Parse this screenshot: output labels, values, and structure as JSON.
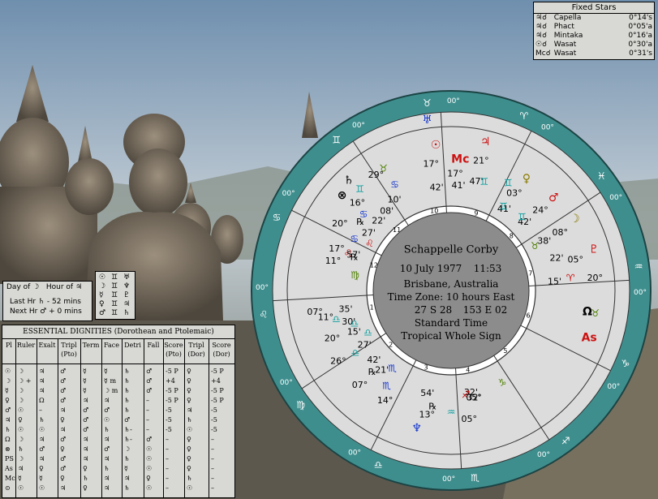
{
  "colors": {
    "outer_ring": "#3f8e8e",
    "house_ring": "#dcdcdc",
    "center": "#8c8c8c",
    "panel": "#d8d8d4",
    "red": "#cc1111",
    "blue": "#1133cc",
    "green": "#4d7f00",
    "olive": "#8a7a00",
    "cyan": "#14a0a0"
  },
  "fixed_stars": {
    "title": "Fixed Stars",
    "rows": [
      {
        "glyph": "♃☌",
        "name": "Capella",
        "value": "0°14's"
      },
      {
        "glyph": "♃☌",
        "name": "Phact",
        "value": "0°05'a"
      },
      {
        "glyph": "♃☌",
        "name": "Mintaka",
        "value": "0°16'a"
      },
      {
        "glyph": "☉☌",
        "name": "Wasat",
        "value": "0°30'a"
      },
      {
        "glyph": "Mc☌",
        "name": "Wasat",
        "value": "0°31's"
      }
    ]
  },
  "day_hour": {
    "day_label": "Day of",
    "day_glyph": "☽",
    "hour_label": "Hour of",
    "hour_glyph": "♃",
    "last_hr_label": "Last Hr",
    "last_hr_glyph": "♄",
    "last_hr_value": "- 52 mins",
    "next_hr_label": "Next Hr",
    "next_hr_glyph": "♂",
    "next_hr_value": "+ 0 mins"
  },
  "planet_grid": [
    [
      "☉",
      "♊",
      "♅"
    ],
    [
      "☽",
      "♊",
      "♆"
    ],
    [
      "☿",
      "♊",
      "♇"
    ],
    [
      "♀",
      "♊",
      "♃"
    ],
    [
      "♂",
      "♊",
      "♄"
    ]
  ],
  "dignities": {
    "title": "ESSENTIAL DIGNITIES  (Dorothean and Ptolemaic)",
    "headers": [
      "Pl",
      "Ruler",
      "Exalt",
      "Tripl (Pto)",
      "Term",
      "Face",
      "Detri",
      "Fall",
      "Score (Pto)",
      "Tripl (Dor)",
      "Score (Dor)"
    ],
    "rows": [
      [
        "☉",
        "☽",
        "♃",
        "♂",
        "☿",
        "☿",
        "♄",
        "♂",
        "-5 P",
        "♀",
        "-5 P"
      ],
      [
        "☽",
        "☽ +",
        "♃",
        "♂",
        "☿",
        "☿ m",
        "♄",
        "♂",
        "+4",
        "♀",
        "+4"
      ],
      [
        "☿",
        "☽",
        "♃",
        "♂",
        "☿",
        "☽ m",
        "♄",
        "♂",
        "-5 P",
        "♀",
        "-5 P"
      ],
      [
        "♀",
        "☽",
        "Ω",
        "♂",
        "♃",
        "♃",
        "♄",
        "–",
        "-5 P",
        "♀",
        "-5 P"
      ],
      [
        "♂",
        "☉",
        "–",
        "♃",
        "♂",
        "♂",
        "♄",
        "–",
        "-5",
        "♃",
        "-5"
      ],
      [
        "♃",
        "♀",
        "♄",
        "♀",
        "♂",
        "☉",
        "♂",
        "–",
        "-5",
        "♄",
        "-5"
      ],
      [
        "♄",
        "☉",
        "☉",
        "♃",
        "♂",
        "♄",
        "♄-",
        "–",
        "-5",
        "☉",
        "-5"
      ],
      [
        "Ω",
        "☽",
        "♃",
        "♂",
        "♃",
        "♃",
        "♄-",
        "♂",
        "–",
        "♀",
        "–"
      ],
      [
        "⊗",
        "♄",
        "♂",
        "♀",
        "♃",
        "♂",
        "☽",
        "☉",
        "–",
        "♀",
        "–"
      ],
      [
        "PS",
        "☽",
        "♃",
        "♂",
        "♃",
        "♃",
        "♄",
        "☉",
        "–",
        "♀",
        "–"
      ],
      [
        "As",
        "♃",
        "♀",
        "♂",
        "♀",
        "♄",
        "☿",
        "☉",
        "–",
        "♀",
        "–"
      ],
      [
        "Mc",
        "☿",
        "☿",
        "♀",
        "♄",
        "♃",
        "♃",
        "♀",
        "–",
        "♄",
        "–"
      ],
      [
        "⊙",
        "☉",
        "☉",
        "♃",
        "♀",
        "♃",
        "♄",
        "☉",
        "–",
        "☉",
        "–"
      ]
    ]
  },
  "chart": {
    "name": "Schappelle Corby",
    "date": "10 July 1977",
    "time": "11:53",
    "place": "Brisbane, Australia",
    "timezone": "Time Zone: 10 hours East",
    "coords_lat": "27 S 28",
    "coords_lon": "153 E 02",
    "time_type": "Standard Time",
    "system": "Tropical Whole Sign"
  },
  "wheel": {
    "sign_cusp_label": "00°",
    "signs": [
      {
        "glyph": "♈",
        "color": "#cc1111"
      },
      {
        "glyph": "♉",
        "color": "#4d7f00"
      },
      {
        "glyph": "♊",
        "color": "#14a0a0"
      },
      {
        "glyph": "♋",
        "color": "#1133cc"
      },
      {
        "glyph": "♌",
        "color": "#cc1111"
      },
      {
        "glyph": "♍",
        "color": "#4d7f00"
      },
      {
        "glyph": "♎",
        "color": "#14a0a0"
      },
      {
        "glyph": "♏",
        "color": "#1133cc"
      },
      {
        "glyph": "♐",
        "color": "#cc1111"
      },
      {
        "glyph": "♑",
        "color": "#4d7f00"
      },
      {
        "glyph": "♒",
        "color": "#14a0a0"
      },
      {
        "glyph": "♓",
        "color": "#1133cc"
      }
    ],
    "houses": [
      "1",
      "2",
      "3",
      "4",
      "5",
      "6",
      "7",
      "8",
      "9",
      "10",
      "11",
      "12"
    ],
    "house_signs": [
      {
        "glyph": "♐",
        "deg": "",
        "color": "#cc1111"
      },
      {
        "glyph": "♑",
        "deg": "05°",
        "color": "#4d7f00"
      },
      {
        "glyph": "♒",
        "deg": "32'",
        "color": "#14a0a0"
      }
    ],
    "bodies": [
      {
        "glyph": "♅",
        "color": "#1133cc",
        "deg": "",
        "min": ""
      },
      {
        "glyph": "☉",
        "color": "#cc1111",
        "deg": "17°",
        "min": "42'"
      },
      {
        "glyph": "Mc",
        "color": "#cc1111",
        "deg": "17°",
        "min": "41'"
      },
      {
        "glyph": "♄",
        "color": "#000000",
        "deg": "29°",
        "min": "10'"
      },
      {
        "glyph": "⊗",
        "color": "#000000",
        "deg": "16°",
        "min": "08'"
      },
      {
        "glyph": "♃",
        "color": "#cc1111",
        "deg": "21°",
        "min": "47'"
      },
      {
        "glyph": "♀",
        "color": "#8a7a00",
        "deg": "03°",
        "min": "41'"
      },
      {
        "glyph": "♂",
        "color": "#cc1111",
        "deg": "24°",
        "min": "42'"
      },
      {
        "glyph": "☽",
        "color": "#8a7a00",
        "deg": "08°",
        "min": "38'"
      },
      {
        "glyph": "♇",
        "color": "#cc1111",
        "deg": "05°",
        "min": "22'"
      },
      {
        "glyph": "Ω",
        "color": "#000000",
        "deg": "20°",
        "min": "15'"
      },
      {
        "glyph": "As",
        "color": "#cc1111",
        "deg": "26°",
        "min": "42'"
      },
      {
        "glyph": "♆",
        "color": "#1133cc",
        "deg": "13°",
        "min": "54'"
      }
    ],
    "labels": [
      {
        "text": "29°",
        "color": "#000000"
      },
      {
        "text": "17°",
        "color": "#000000"
      },
      {
        "text": "17°",
        "color": "#000000"
      },
      {
        "text": "21°",
        "color": "#000000"
      },
      {
        "text": "03°",
        "color": "#000000"
      },
      {
        "text": "24°",
        "color": "#000000"
      },
      {
        "text": "08°",
        "color": "#000000"
      },
      {
        "text": "05°",
        "color": "#000000"
      },
      {
        "text": "20°",
        "color": "#000000"
      },
      {
        "text": "16°",
        "color": "#000000"
      },
      {
        "text": "20°",
        "color": "#000000"
      },
      {
        "text": "17°",
        "color": "#000000"
      },
      {
        "text": "11°",
        "color": "#000000"
      },
      {
        "text": "07°",
        "color": "#000000"
      },
      {
        "text": "11°",
        "color": "#000000"
      },
      {
        "text": "20°",
        "color": "#000000"
      },
      {
        "text": "26°",
        "color": "#000000"
      },
      {
        "text": "07°",
        "color": "#000000"
      },
      {
        "text": "14°",
        "color": "#000000"
      },
      {
        "text": "13°",
        "color": "#000000"
      },
      {
        "text": "05°",
        "color": "#000000"
      },
      {
        "text": "42'",
        "color": "#000000"
      },
      {
        "text": "41'",
        "color": "#000000"
      },
      {
        "text": "47'",
        "color": "#000000"
      },
      {
        "text": "41'",
        "color": "#000000"
      },
      {
        "text": "42'",
        "color": "#000000"
      },
      {
        "text": "38'",
        "color": "#000000"
      },
      {
        "text": "22'",
        "color": "#000000"
      },
      {
        "text": "15'",
        "color": "#000000"
      },
      {
        "text": "10'",
        "color": "#000000"
      },
      {
        "text": "08'",
        "color": "#000000"
      },
      {
        "text": "22'",
        "color": "#000000"
      },
      {
        "text": "27'",
        "color": "#000000"
      },
      {
        "text": "57'",
        "color": "#000000"
      },
      {
        "text": "35'",
        "color": "#000000"
      },
      {
        "text": "30'",
        "color": "#000000"
      },
      {
        "text": "15'",
        "color": "#000000"
      },
      {
        "text": "27'",
        "color": "#000000"
      },
      {
        "text": "42'",
        "color": "#000000"
      },
      {
        "text": "21'",
        "color": "#000000"
      },
      {
        "text": "54'",
        "color": "#000000"
      },
      {
        "text": "32'",
        "color": "#000000"
      },
      {
        "text": "℞",
        "color": "#000000"
      },
      {
        "text": "℞",
        "color": "#000000"
      },
      {
        "text": "℞",
        "color": "#000000"
      },
      {
        "text": "℞",
        "color": "#000000"
      }
    ]
  }
}
